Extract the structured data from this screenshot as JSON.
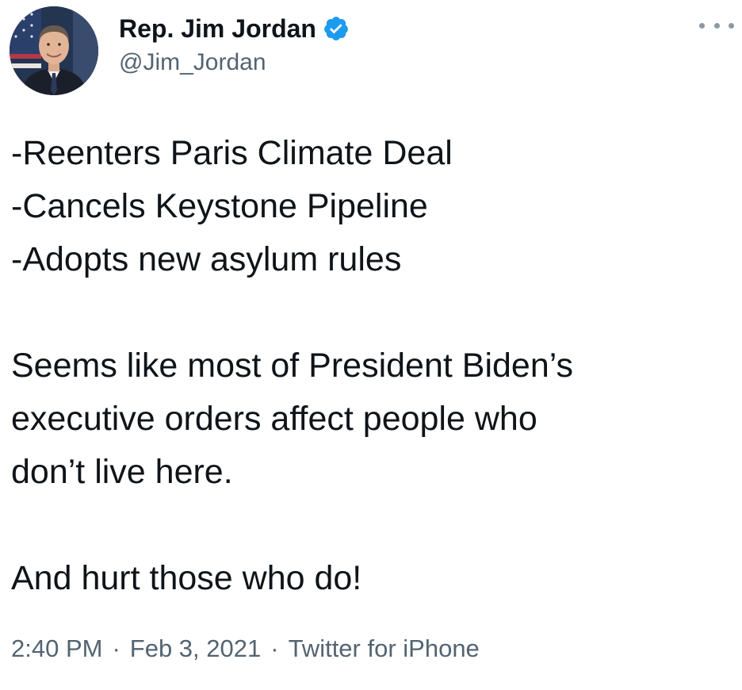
{
  "author": {
    "display_name": "Rep. Jim Jordan",
    "handle": "@Jim_Jordan",
    "avatar_icon": "profile-photo",
    "verified_icon": "verified-badge-icon",
    "verified_color": "#1d9bf0"
  },
  "menu": {
    "icon": "more-options-icon"
  },
  "tweet": {
    "lines": [
      "-Reenters Paris Climate Deal",
      "-Cancels Keystone Pipeline",
      "-Adopts new asylum rules",
      "",
      "Seems like most of President Biden’s",
      "executive orders affect people who",
      "don’t live here.",
      "",
      "And hurt those who do!"
    ]
  },
  "meta": {
    "time": "2:40 PM",
    "separator": "·",
    "date": "Feb 3, 2021",
    "source": "Twitter for iPhone",
    "text_color": "#536471"
  }
}
